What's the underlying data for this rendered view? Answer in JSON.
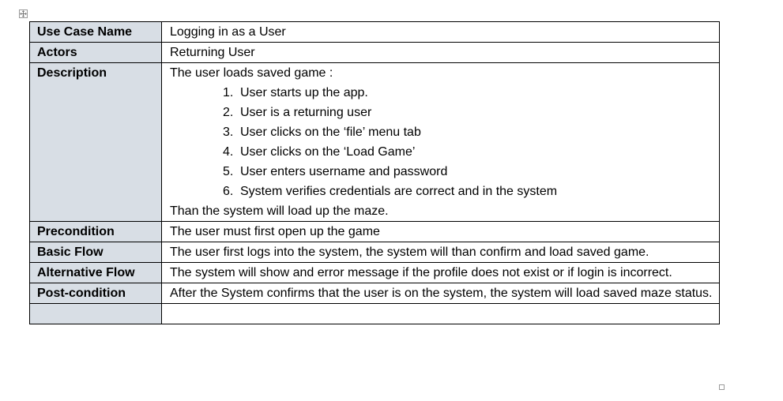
{
  "document": {
    "rows": [
      {
        "label": "Use Case Name",
        "value": "Logging in as a User"
      },
      {
        "label": "Actors",
        "value": "Returning User"
      },
      {
        "label": "Description",
        "intro": "The user loads saved game :",
        "steps": [
          {
            "num": "1.",
            "text": "User starts up the app."
          },
          {
            "num": "2.",
            "text": "User is a returning user"
          },
          {
            "num": "3.",
            "text": "User clicks on the ‘file’ menu tab"
          },
          {
            "num": "4.",
            "text": "User clicks on the ‘Load Game’"
          },
          {
            "num": "5.",
            "text": "User enters username and password"
          },
          {
            "num": "6.",
            "text": "System verifies credentials are correct and in the system"
          }
        ],
        "outro": "Than the system will load up the maze."
      },
      {
        "label": "Precondition",
        "value": "The user must first open up the game"
      },
      {
        "label": "Basic Flow",
        "value": "The user first logs into the system, the system will than confirm and load saved game."
      },
      {
        "label": "Alternative Flow",
        "value": "The system will show and error message if the profile does not exist or if login is incorrect."
      },
      {
        "label": "Post-condition",
        "value": "After the System confirms that the user is on the system, the system will load saved maze status."
      },
      {
        "label": "",
        "value": ""
      }
    ]
  }
}
